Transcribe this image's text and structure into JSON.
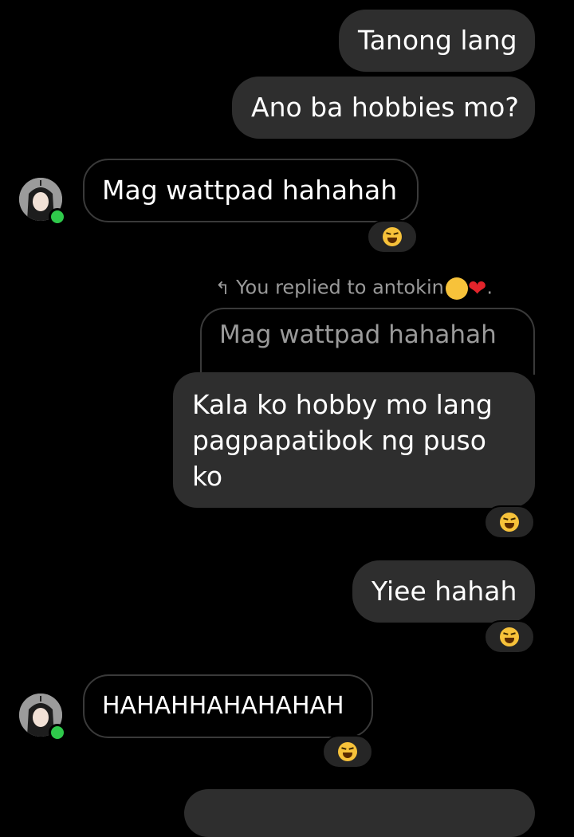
{
  "messages": [
    {
      "text": "Tanong lang"
    },
    {
      "text": "Ano ba hobbies mo?"
    },
    {
      "text": "Mag wattpad hahahah"
    },
    {
      "text": "Kala ko hobby mo lang pagpapatibok ng puso ko",
      "lines": [
        "Kala ko hobby mo lang",
        "pagpapatibok ng puso",
        "ko"
      ]
    },
    {
      "text": "Yiee hahah"
    },
    {
      "text": "HAHAHHAHAHAHAH"
    }
  ],
  "reply": {
    "label": "You replied to antokin",
    "quoted": "Mag wattpad hahahah"
  },
  "reaction_icon": "laughing-emoji-icon",
  "colors": {
    "bubble_out": "#2e2e2e",
    "bubble_in_border": "#3a3a3a",
    "online": "#2fc94b",
    "heart": "#e3242b"
  }
}
